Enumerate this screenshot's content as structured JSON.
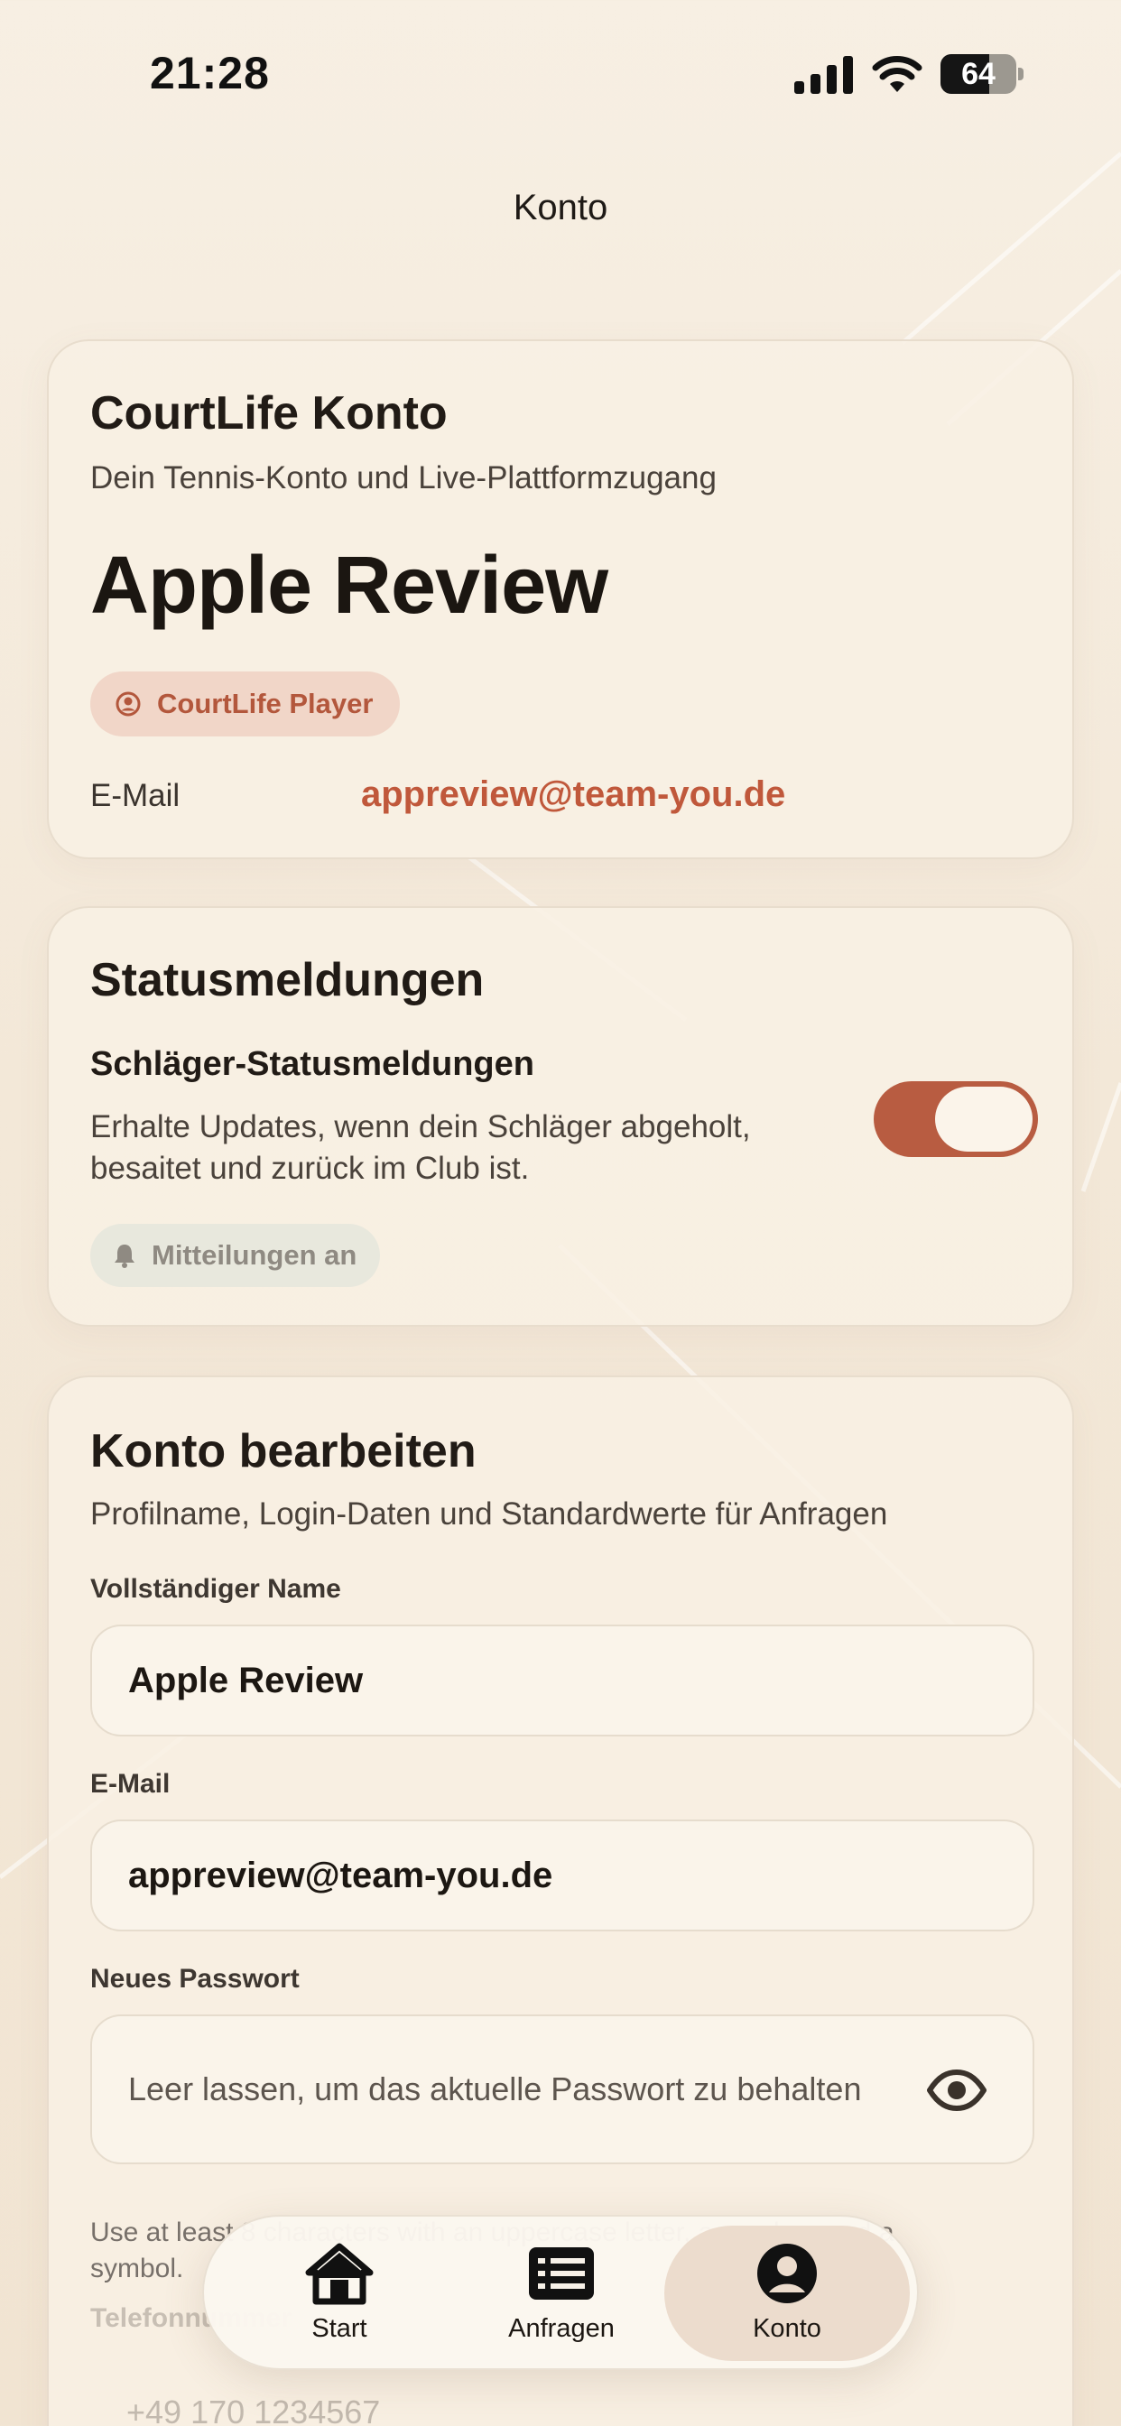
{
  "status_bar": {
    "time": "21:28",
    "battery_level": "64",
    "battery_fraction": 0.64
  },
  "nav": {
    "title": "Konto"
  },
  "account_card": {
    "title": "CourtLife Konto",
    "subtitle": "Dein Tennis-Konto und Live-Plattformzugang",
    "display_name": "Apple Review",
    "role_badge": "CourtLife Player",
    "email_label": "E-Mail",
    "email_value": "appreview@team-you.de"
  },
  "status_card": {
    "title": "Statusmeldungen",
    "setting_label": "Schläger-Statusmeldungen",
    "setting_description": "Erhalte Updates, wenn dein Schläger abgeholt, besaitet und zurück im Club ist.",
    "toggle_on": true,
    "notification_badge": "Mitteilungen an"
  },
  "edit_card": {
    "title": "Konto bearbeiten",
    "subtitle": "Profilname, Login-Daten und Standardwerte für Anfragen",
    "fields": [
      {
        "label": "Vollständiger Name",
        "value": "Apple Review"
      },
      {
        "label": "E-Mail",
        "value": "appreview@team-you.de"
      },
      {
        "label": "Neues Passwort",
        "placeholder": "Leer lassen, um das aktuelle Passwort zu behalten"
      }
    ],
    "password_hint": "Use at least 8 characters with an uppercase letter, a number, and a symbol.",
    "phone_label": "Telefonnummer",
    "phone_placeholder": "+49 170 1234567"
  },
  "tab_bar": {
    "active": "Konto",
    "tabs": [
      {
        "label": "Start",
        "icon": "home-icon"
      },
      {
        "label": "Anfragen",
        "icon": "list-icon"
      },
      {
        "label": "Konto",
        "icon": "account-icon"
      }
    ]
  },
  "colors": {
    "accent": "#c0583b",
    "toggle_on": "#b85c41",
    "badge_bg": "#f1d6c8",
    "background": "#f5ecdf",
    "text": "#231d18"
  }
}
